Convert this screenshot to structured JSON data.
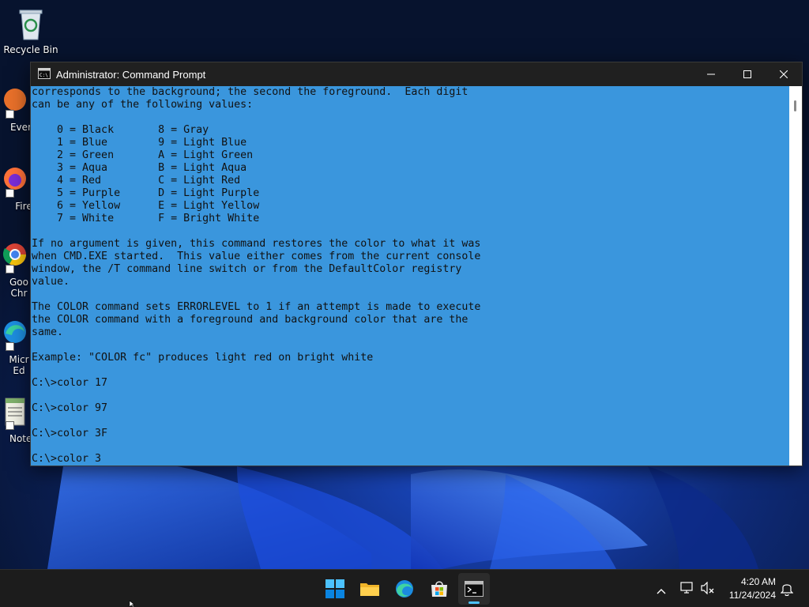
{
  "desktop": {
    "icons": [
      {
        "label": "Recycle Bin"
      },
      {
        "label": "Every"
      },
      {
        "label": "Fire"
      },
      {
        "label": "Goo Chr"
      },
      {
        "label": "Micr Ed"
      },
      {
        "label": "Notep"
      }
    ]
  },
  "window": {
    "title": "Administrator: Command Prompt",
    "app_icon": "cmd-icon",
    "buttons": {
      "minimize": "minimize-icon",
      "maximize": "maximize-icon",
      "close": "close-icon"
    },
    "console_bg": "#3a96dd",
    "console_fg": "#111111",
    "console_lines": [
      "corresponds to the background; the second the foreground.  Each digit",
      "can be any of the following values:",
      "",
      "    0 = Black       8 = Gray",
      "    1 = Blue        9 = Light Blue",
      "    2 = Green       A = Light Green",
      "    3 = Aqua        B = Light Aqua",
      "    4 = Red         C = Light Red",
      "    5 = Purple      D = Light Purple",
      "    6 = Yellow      E = Light Yellow",
      "    7 = White       F = Bright White",
      "",
      "If no argument is given, this command restores the color to what it was",
      "when CMD.EXE started.  This value either comes from the current console",
      "window, the /T command line switch or from the DefaultColor registry",
      "value.",
      "",
      "The COLOR command sets ERRORLEVEL to 1 if an attempt is made to execute",
      "the COLOR command with a foreground and background color that are the",
      "same.",
      "",
      "Example: \"COLOR fc\" produces light red on bright white",
      "",
      "C:\\>color 17",
      "",
      "C:\\>color 97",
      "",
      "C:\\>color 3F",
      "",
      "C:\\>color 3"
    ]
  },
  "taskbar": {
    "apps": [
      {
        "name": "start-icon"
      },
      {
        "name": "file-explorer-icon"
      },
      {
        "name": "edge-icon"
      },
      {
        "name": "store-icon"
      },
      {
        "name": "command-prompt-icon",
        "active": true
      }
    ],
    "tray": [
      "chevron-up-icon",
      "network-icon",
      "volume-muted-icon",
      "notification-bell-icon"
    ],
    "time": "4:20 AM",
    "date": "11/24/2024"
  }
}
